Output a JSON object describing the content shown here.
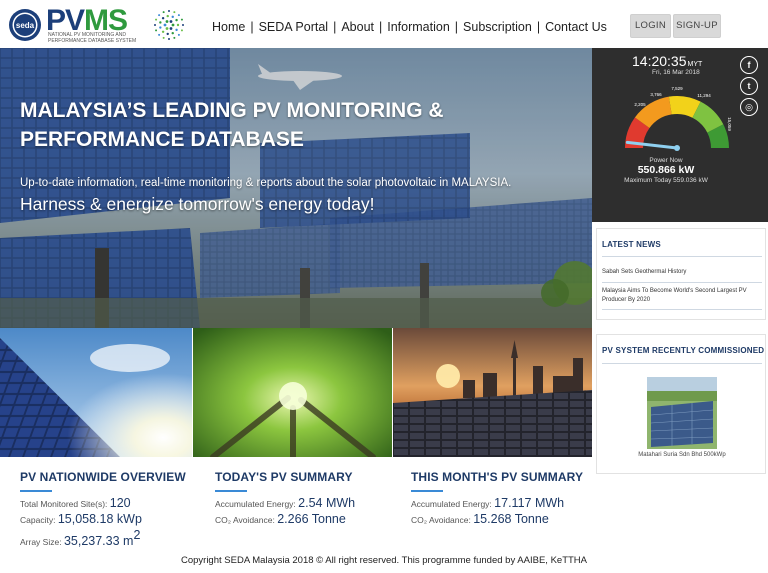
{
  "header": {
    "brand_left": "PV",
    "brand_right": "MS",
    "brand_sub": "National PV Monitoring and Performance Database System",
    "seal_text": "seda",
    "nav": [
      "Home",
      "SEDA Portal",
      "About",
      "Information",
      "Subscription",
      "Contact Us"
    ],
    "login_label": "LOGIN",
    "signup_label": "SIGN-UP"
  },
  "hero": {
    "title": "MALAYSIA’S LEADING PV MONITORING & PERFORMANCE DATABASE",
    "subtitle": "Up-to-date information, real-time monitoring & reports about the solar photovoltaic in MALAYSIA.",
    "tagline": "Harness & energize tomorrow's energy today!"
  },
  "clock": {
    "time": "14:20:35",
    "tz": "MYT",
    "date": "Fri, 16 Mar 2018"
  },
  "gauge": {
    "ticks": [
      "2,205",
      "3,766",
      "7,529",
      "11,294",
      "15,059"
    ],
    "power_label": "Power Now",
    "power_value": "550.866 kW",
    "power_max": "Maximum Today 559.036 kW",
    "needle_fraction": 0.036
  },
  "social": {
    "facebook": "f",
    "twitter": "t",
    "instagram": "◎"
  },
  "news": {
    "title": "LATEST NEWS",
    "items": [
      "Sabah Sets Geothermal History",
      "Malaysia Aims To Become World's Second Largest PV Producer By 2020"
    ]
  },
  "commissioned": {
    "title": "PV SYSTEM RECENTLY COMMISSIONED",
    "caption": "Matahari Suria Sdn Bhd 500kWp"
  },
  "stats": {
    "nationwide": {
      "title": "PV NATIONWIDE OVERVIEW",
      "rows": [
        {
          "label": "Total Monitored Site(s):",
          "value": "120"
        },
        {
          "label": "Capacity:",
          "value": "15,058.18 kWp"
        },
        {
          "label": "Array Size:",
          "value": "35,237.33 m",
          "sup": "2"
        }
      ]
    },
    "today": {
      "title": "TODAY'S PV SUMMARY",
      "rows": [
        {
          "label": "Accumulated Energy:",
          "value": "2.54 MWh"
        },
        {
          "label": "CO₂ Avoidance:",
          "value": "2.266 Tonne"
        }
      ]
    },
    "month": {
      "title": "THIS MONTH'S PV SUMMARY",
      "rows": [
        {
          "label": "Accumulated Energy:",
          "value": "17.117 MWh"
        },
        {
          "label": "CO₂ Avoidance:",
          "value": "15.268 Tonne"
        }
      ]
    }
  },
  "footer": {
    "text": "Copyright SEDA Malaysia 2018 © All right reserved. This programme funded by AAIBE, KeTTHA"
  },
  "colors": {
    "navy": "#1e3a66",
    "accent": "#3a8ad6",
    "gauge_red": "#e03a2f",
    "gauge_orange": "#f39a1e",
    "gauge_yellow": "#f2d21a",
    "gauge_green": "#7fc241",
    "gauge_dark_green": "#3e9a34"
  }
}
